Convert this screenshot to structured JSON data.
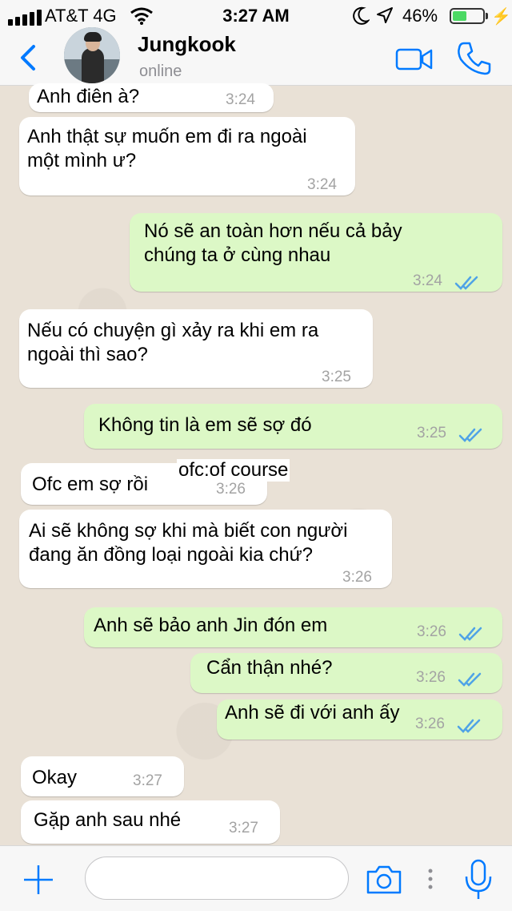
{
  "status": {
    "carrier": "AT&T 4G",
    "time": "3:27 AM",
    "battery": "46%",
    "battery_level": 0.46,
    "icons": [
      "signal-icon",
      "wifi-icon",
      "moon-icon",
      "location-icon",
      "battery-icon",
      "charging-icon"
    ]
  },
  "header": {
    "name": "Jungkook",
    "status": "online",
    "icons": [
      "back-chevron-icon",
      "avatar",
      "video-call-icon",
      "phone-icon"
    ]
  },
  "accent": "#007aff",
  "colors": {
    "incoming": "#ffffff",
    "outgoing": "#dcf8c6",
    "ticks": "#4fa3e6"
  },
  "messages": [
    {
      "dir": "in",
      "text": "Anh điên à?",
      "time": "3:24"
    },
    {
      "dir": "in",
      "text": "Anh thật sự muốn em đi ra ngoài\nmột mình ư?",
      "time": "3:24"
    },
    {
      "dir": "out",
      "text": "Nó sẽ an toàn hơn nếu cả bảy\nchúng ta ở cùng nhau",
      "time": "3:24"
    },
    {
      "dir": "in",
      "text": "Nếu có chuyện gì xảy ra khi em ra\nngoài thì sao?",
      "time": "3:25"
    },
    {
      "dir": "out",
      "text": "Không tin là em sẽ sợ đó",
      "time": "3:25"
    },
    {
      "dir": "in",
      "text": "Ofc em sợ rồi",
      "time": "3:26"
    },
    {
      "dir": "in",
      "text": "Ai sẽ không sợ khi mà biết con người\nđang ăn đồng loại ngoài kia chứ?",
      "time": "3:26"
    },
    {
      "dir": "out",
      "text": "Anh sẽ bảo anh Jin đón em",
      "time": "3:26"
    },
    {
      "dir": "out",
      "text": "Cẩn thận nhé?",
      "time": "3:26"
    },
    {
      "dir": "out",
      "text": "Anh sẽ đi với anh ấy",
      "time": "3:26"
    },
    {
      "dir": "in",
      "text": "Okay",
      "time": "3:27"
    },
    {
      "dir": "in",
      "text": "Gặp anh sau nhé",
      "time": "3:27"
    }
  ],
  "annotation": "ofc:of course",
  "input": {
    "placeholder": "",
    "icons": [
      "plus-icon",
      "camera-icon",
      "more-dots-icon",
      "microphone-icon"
    ]
  }
}
